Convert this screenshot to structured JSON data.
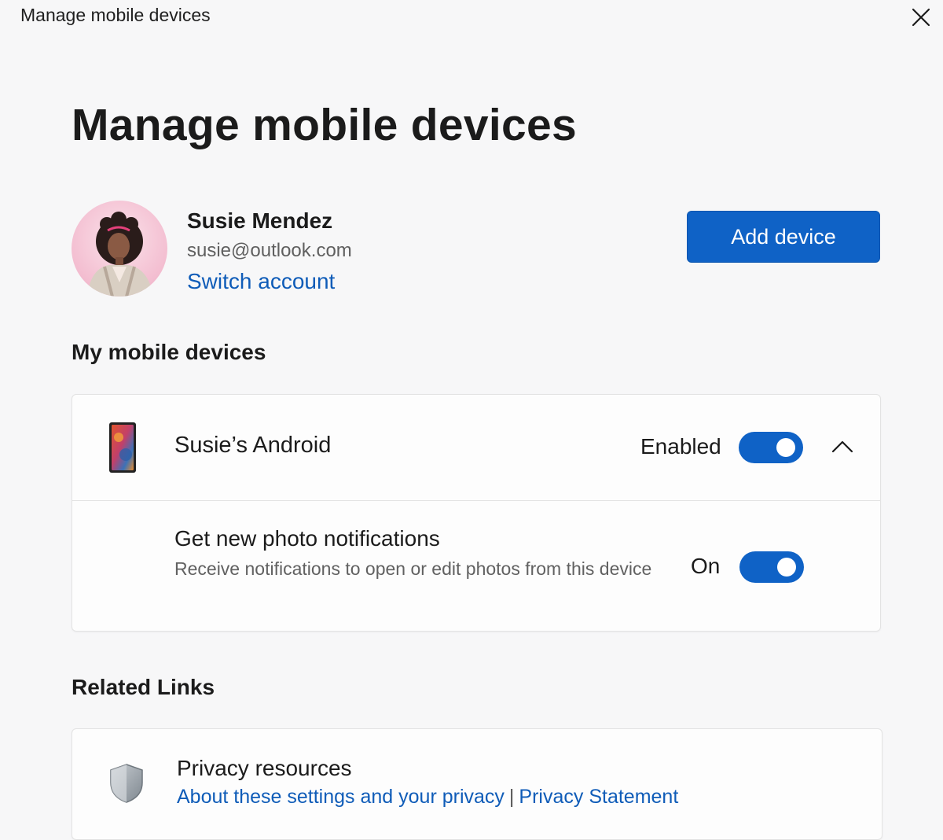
{
  "window": {
    "title": "Manage mobile devices"
  },
  "page": {
    "title": "Manage mobile devices"
  },
  "account": {
    "name": "Susie Mendez",
    "email": "susie@outlook.com",
    "switch_label": "Switch account",
    "add_device_label": "Add device"
  },
  "devices_section": {
    "heading": "My mobile devices",
    "devices": [
      {
        "name": "Susie’s Android",
        "status_label": "Enabled",
        "enabled": true,
        "expanded": true,
        "settings": [
          {
            "title": "Get new photo notifications",
            "description": "Receive notifications to open or edit photos from this device",
            "state_label": "On",
            "on": true
          }
        ]
      }
    ]
  },
  "related_section": {
    "heading": "Related Links",
    "privacy": {
      "title": "Privacy resources",
      "link_about": "About these settings and your privacy",
      "separator": "|",
      "link_statement": "Privacy Statement"
    }
  },
  "icons": {
    "close": "close-icon",
    "phone": "phone-icon",
    "chevron": "chevron-up-icon",
    "shield": "shield-icon"
  },
  "colors": {
    "accent": "#0f62c6",
    "link": "#0f5cb8",
    "background": "#f7f7f8"
  }
}
